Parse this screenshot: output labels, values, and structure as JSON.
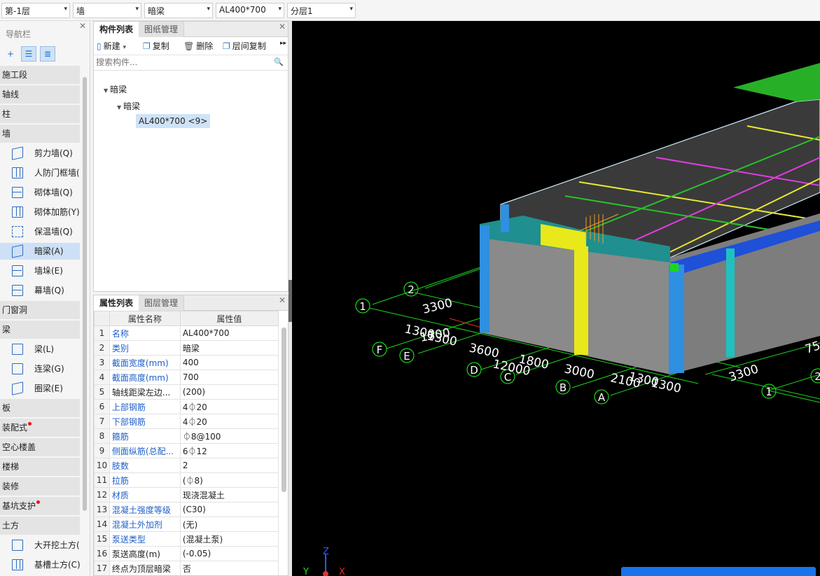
{
  "topbar": {
    "floor": "第-1层",
    "category": "墙",
    "type": "暗梁",
    "component": "AL400*700",
    "layer": "分层1"
  },
  "nav": {
    "title": "导航栏",
    "categories": {
      "c0": "施工段",
      "c1": "轴线",
      "c2": "柱",
      "c3": "墙",
      "c4": "门窗洞",
      "c5": "梁",
      "c6": "板",
      "c7": "装配式",
      "c8": "空心楼盖",
      "c9": "楼梯",
      "c10": "装修",
      "c11": "基坑支护",
      "c12": "土方"
    },
    "wall_items": {
      "w0": "剪力墙(Q)",
      "w1": "人防门框墙(",
      "w2": "砌体墙(Q)",
      "w3": "砌体加筋(Y)",
      "w4": "保温墙(Q)",
      "w5": "暗梁(A)",
      "w6": "墙垛(E)",
      "w7": "幕墙(Q)"
    },
    "beam_items": {
      "b0": "梁(L)",
      "b1": "连梁(G)",
      "b2": "圈梁(E)"
    },
    "earth_items": {
      "e0": "大开挖土方(",
      "e1": "基槽土方(C)"
    }
  },
  "component_panel": {
    "tab_active": "构件列表",
    "tab_inactive": "图纸管理",
    "actions": {
      "new": "新建",
      "copy": "复制",
      "delete": "删除",
      "copy_floor": "层间复制"
    },
    "search_placeholder": "搜索构件...",
    "tree": {
      "root": "暗梁",
      "child": "暗梁",
      "leaf": "AL400*700 <9>"
    }
  },
  "property_panel": {
    "tab_active": "属性列表",
    "tab_inactive": "图层管理",
    "col_name": "属性名称",
    "col_value": "属性值",
    "rows": [
      {
        "n": "1",
        "k": "名称",
        "v": "AL400*700",
        "blue": true
      },
      {
        "n": "2",
        "k": "类别",
        "v": "暗梁",
        "blue": true
      },
      {
        "n": "3",
        "k": "截面宽度(mm)",
        "v": "400",
        "blue": true
      },
      {
        "n": "4",
        "k": "截面高度(mm)",
        "v": "700",
        "blue": true
      },
      {
        "n": "5",
        "k": "轴线距梁左边...",
        "v": "(200)",
        "blue": false
      },
      {
        "n": "6",
        "k": "上部钢筋",
        "v": "4⏀20",
        "blue": true
      },
      {
        "n": "7",
        "k": "下部钢筋",
        "v": "4⏀20",
        "blue": true
      },
      {
        "n": "8",
        "k": "箍筋",
        "v": "⏀8@100",
        "blue": true
      },
      {
        "n": "9",
        "k": "侧面纵筋(总配...",
        "v": "6⏀12",
        "blue": true
      },
      {
        "n": "10",
        "k": "肢数",
        "v": "2",
        "blue": true
      },
      {
        "n": "11",
        "k": "拉筋",
        "v": "(⏀8)",
        "blue": true
      },
      {
        "n": "12",
        "k": "材质",
        "v": "现浇混凝土",
        "blue": true
      },
      {
        "n": "13",
        "k": "混凝土强度等级",
        "v": "(C30)",
        "blue": true
      },
      {
        "n": "14",
        "k": "混凝土外加剂",
        "v": "(无)",
        "blue": true
      },
      {
        "n": "15",
        "k": "泵送类型",
        "v": "(混凝土泵)",
        "blue": true
      },
      {
        "n": "16",
        "k": "泵送高度(m)",
        "v": "(-0.05)",
        "blue": false
      },
      {
        "n": "17",
        "k": "终点为顶层暗梁",
        "v": "否",
        "blue": false
      }
    ]
  },
  "viewport": {
    "axis_labels": [
      "1",
      "2",
      "F",
      "E",
      "D",
      "C",
      "B",
      "A",
      "1",
      "2"
    ],
    "dims": [
      "3300",
      "1300",
      "1300",
      "1500",
      "3600",
      "1800",
      "12000",
      "3000",
      "2100",
      "1300",
      "1300",
      "3300",
      "75"
    ],
    "gizmo_labels": [
      "Z",
      "Y",
      "X"
    ]
  }
}
